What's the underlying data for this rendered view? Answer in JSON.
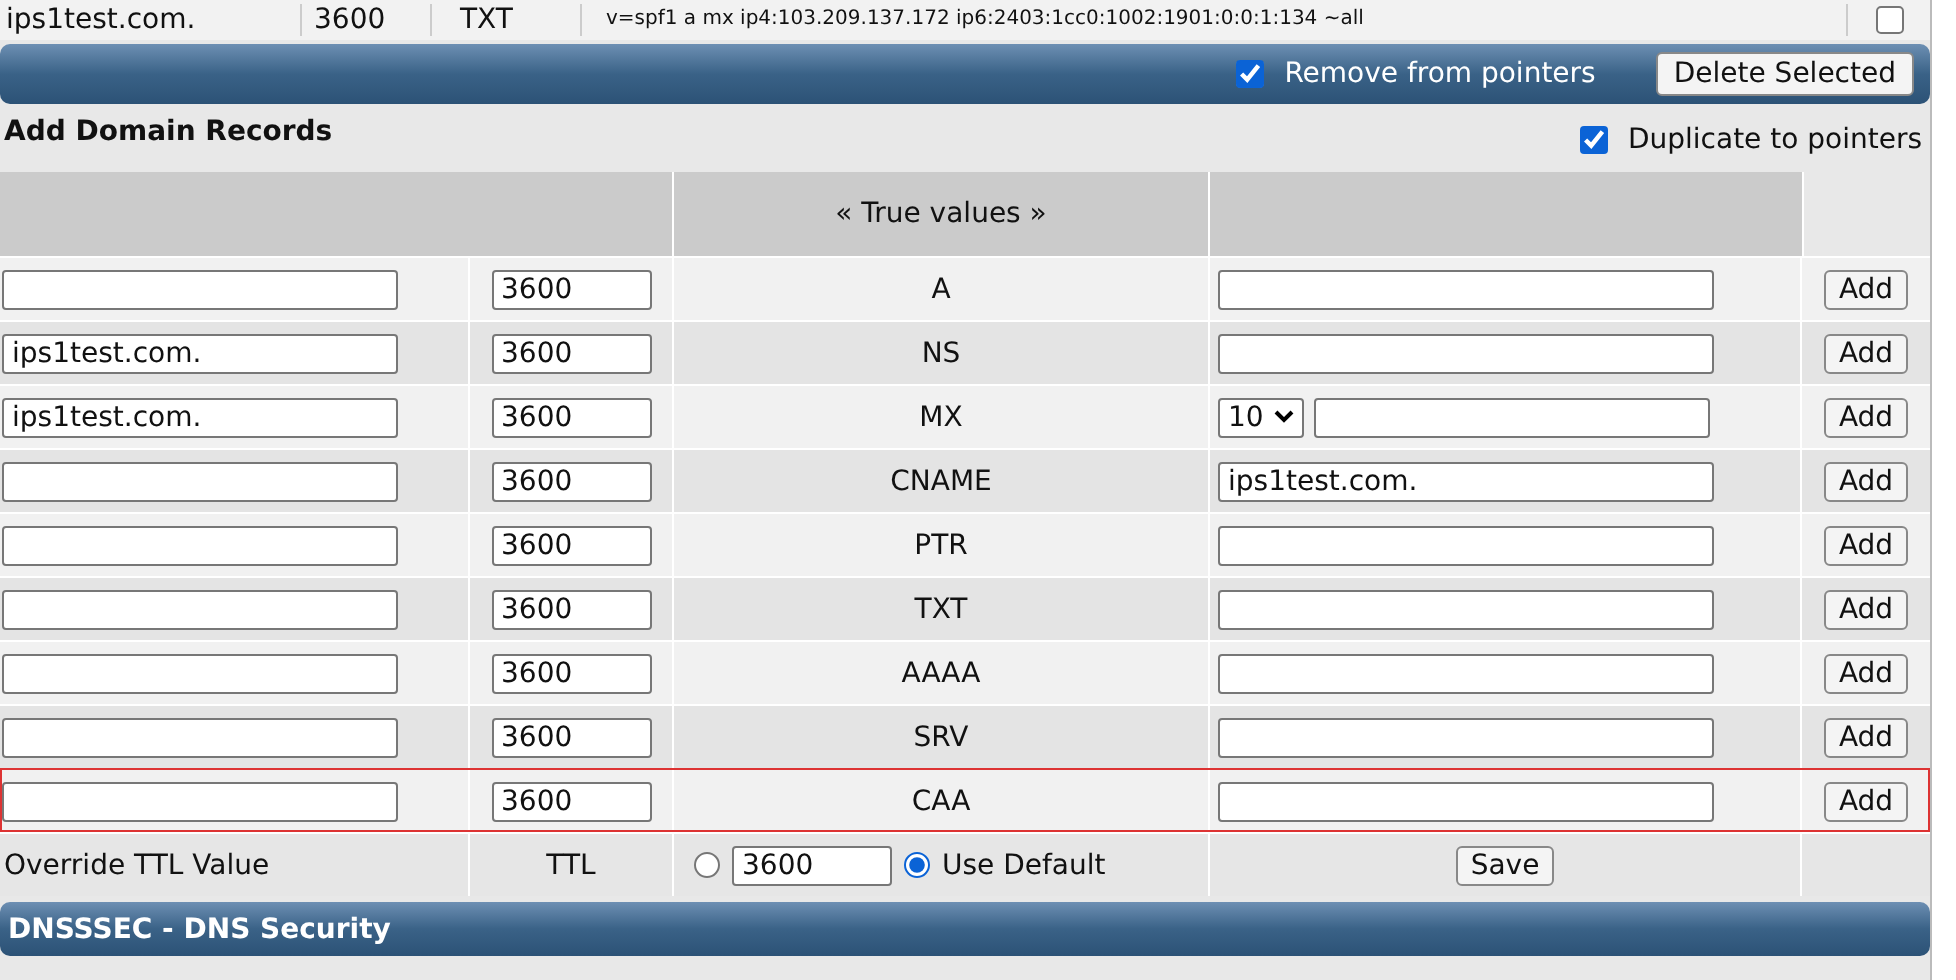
{
  "previous_record": {
    "name": "ips1test.com.",
    "ttl": "3600",
    "type": "TXT",
    "value": "v=spf1 a mx ip4:103.209.137.172 ip6:2403:1cc0:1002:1901:0:0:1:134 ~all",
    "checked": false
  },
  "delete_bar": {
    "remove_from_pointers": {
      "label": "Remove from pointers",
      "checked": true
    },
    "button": "Delete Selected"
  },
  "add_section": {
    "title": "Add Domain Records",
    "duplicate_to_pointers": {
      "label": "Duplicate to pointers",
      "checked": true
    }
  },
  "header": {
    "true_values": "« True values »"
  },
  "records": [
    {
      "kind": "plain",
      "ttl": "3600",
      "type": "A",
      "button": "Add",
      "outlined": false
    },
    {
      "kind": "plain",
      "name": "ips1test.com.",
      "ttl": "3600",
      "type": "NS",
      "button": "Add",
      "outlined": false
    },
    {
      "kind": "mx",
      "name": "ips1test.com.",
      "ttl": "3600",
      "type": "MX",
      "priority": "10",
      "button": "Add",
      "outlined": false
    },
    {
      "kind": "plain",
      "ttl": "3600",
      "type": "CNAME",
      "value": "ips1test.com.",
      "button": "Add",
      "outlined": false
    },
    {
      "kind": "plain",
      "ttl": "3600",
      "type": "PTR",
      "button": "Add",
      "outlined": false
    },
    {
      "kind": "plain",
      "ttl": "3600",
      "type": "TXT",
      "button": "Add",
      "outlined": false
    },
    {
      "kind": "plain",
      "ttl": "3600",
      "type": "AAAA",
      "button": "Add",
      "outlined": false
    },
    {
      "kind": "plain",
      "ttl": "3600",
      "type": "SRV",
      "button": "Add",
      "outlined": false
    },
    {
      "kind": "plain",
      "ttl": "3600",
      "type": "CAA",
      "button": "Add",
      "outlined": true
    }
  ],
  "ttl_row": {
    "label": "Override TTL Value",
    "ttl_label": "TTL",
    "custom": {
      "selected": false,
      "value": "3600"
    },
    "default": {
      "selected": true,
      "label": "Use Default"
    },
    "button": "Save"
  },
  "dnssec_bar": {
    "title": "DNSSSEC - DNS Security"
  }
}
